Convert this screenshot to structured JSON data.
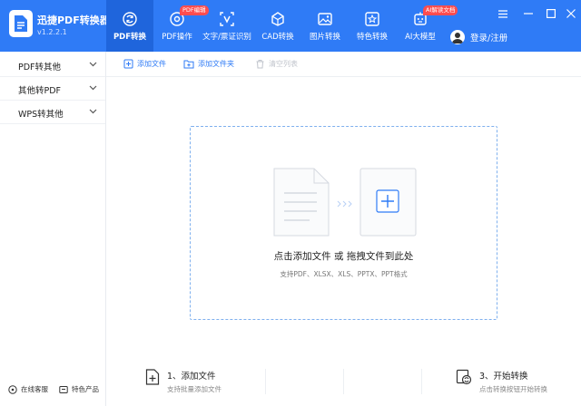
{
  "app": {
    "title": "迅捷PDF转换器",
    "version": "v1.2.2.1"
  },
  "nav": [
    {
      "label": "PDF转换",
      "icon": "refresh-icon",
      "active": true
    },
    {
      "label": "PDF操作",
      "icon": "settings-icon",
      "badge": "PDF编辑"
    },
    {
      "label": "文字/票证识别",
      "icon": "ocr-icon"
    },
    {
      "label": "CAD转换",
      "icon": "cad-icon"
    },
    {
      "label": "图片转换",
      "icon": "image-icon"
    },
    {
      "label": "特色转换",
      "icon": "star-icon"
    },
    {
      "label": "AI大模型",
      "icon": "ai-icon",
      "badge": "AI解读文档"
    }
  ],
  "login": {
    "label": "登录/注册"
  },
  "sidebar": {
    "items": [
      {
        "label": "PDF转其他"
      },
      {
        "label": "其他转PDF"
      },
      {
        "label": "WPS转其他"
      }
    ],
    "footer": [
      {
        "label": "在线客服",
        "icon": "headset-icon"
      },
      {
        "label": "特色产品",
        "icon": "product-icon"
      }
    ]
  },
  "toolbar": {
    "add_file": "添加文件",
    "add_folder": "添加文件夹",
    "clear_list": "清空列表"
  },
  "dropzone": {
    "main": "点击添加文件 或 拖拽文件到此处",
    "sub": "支持PDF、XLSX、XLS、PPTX、PPT格式"
  },
  "steps": [
    {
      "title": "1、添加文件",
      "desc": "支持批量添加文件"
    },
    {
      "title": "3、开始转换",
      "desc": "点击转换按钮开始转换"
    }
  ],
  "colors": {
    "brand": "#2f7bf6",
    "active_tab": "#1f65dc",
    "badge": "#ff4d4f",
    "dashed_border": "#7fb0ee"
  }
}
